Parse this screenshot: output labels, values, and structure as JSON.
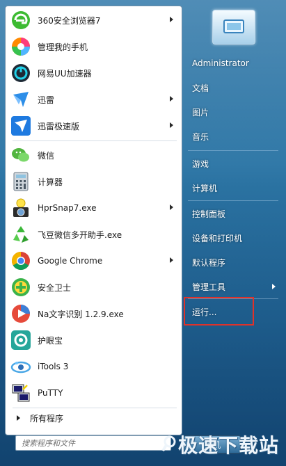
{
  "left_menu": {
    "items": [
      {
        "label": "360安全浏览器7",
        "icon": "360-browser-icon",
        "has_submenu": true
      },
      {
        "label": "管理我的手机",
        "icon": "phone-manager-icon",
        "has_submenu": false
      },
      {
        "label": "网易UU加速器",
        "icon": "uu-accelerator-icon",
        "has_submenu": false
      },
      {
        "label": "迅雷",
        "icon": "xunlei-icon",
        "has_submenu": true
      },
      {
        "label": "迅雷极速版",
        "icon": "xunlei-express-icon",
        "has_submenu": true
      },
      {
        "label": "微信",
        "icon": "wechat-icon",
        "has_submenu": false
      },
      {
        "label": "计算器",
        "icon": "calculator-icon",
        "has_submenu": false
      },
      {
        "label": "HprSnap7.exe",
        "icon": "hypersnap-icon",
        "has_submenu": true
      },
      {
        "label": "飞豆微信多开助手.exe",
        "icon": "recycle-icon",
        "has_submenu": false
      },
      {
        "label": "Google Chrome",
        "icon": "chrome-icon",
        "has_submenu": true
      },
      {
        "label": "安全卫士",
        "icon": "360-safeguard-icon",
        "has_submenu": false
      },
      {
        "label": "Na文字识别 1.2.9.exe",
        "icon": "ocr-play-icon",
        "has_submenu": false
      },
      {
        "label": "护眼宝",
        "icon": "eye-care-icon",
        "has_submenu": false
      },
      {
        "label": "iTools 3",
        "icon": "itools-icon",
        "has_submenu": false
      },
      {
        "label": "PuTTY",
        "icon": "putty-icon",
        "has_submenu": false
      }
    ],
    "all_programs": "所有程序",
    "search_placeholder": "搜索程序和文件"
  },
  "right_menu": {
    "items": [
      {
        "label": "Administrator",
        "has_submenu": false
      },
      {
        "label": "文档",
        "has_submenu": false
      },
      {
        "label": "图片",
        "has_submenu": false
      },
      {
        "label": "音乐",
        "has_submenu": false
      },
      {
        "label": "游戏",
        "has_submenu": false
      },
      {
        "label": "计算机",
        "has_submenu": false
      },
      {
        "label": "控制面板",
        "has_submenu": false
      },
      {
        "label": "设备和打印机",
        "has_submenu": false
      },
      {
        "label": "默认程序",
        "has_submenu": false
      },
      {
        "label": "管理工具",
        "has_submenu": true
      },
      {
        "label": "运行...",
        "has_submenu": false
      }
    ],
    "shutdown_label": "关机"
  },
  "watermark": "极速下载站",
  "colors": {
    "highlight_border": "#e0322a",
    "menu_text_right": "#ffffff"
  }
}
